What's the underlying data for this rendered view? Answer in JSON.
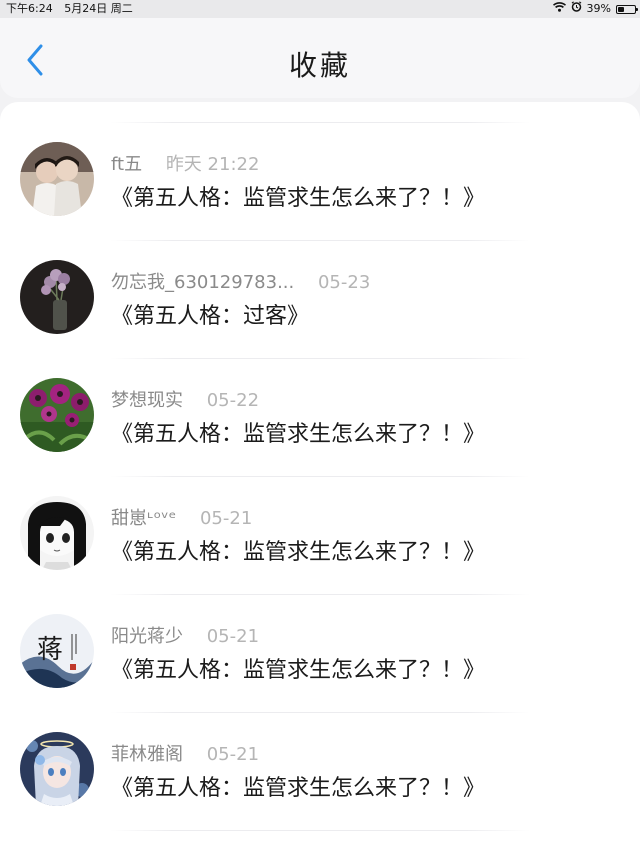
{
  "status_bar": {
    "time": "下午6:24",
    "date": "5月24日 周二",
    "battery_label": "39%",
    "battery_level": 0.39
  },
  "header": {
    "title": "收藏"
  },
  "colors": {
    "accent": "#2f8fe8"
  },
  "icons": {
    "back": "chevron-left-icon",
    "wifi": "wifi-icon",
    "alarm": "alarm-icon",
    "battery": "battery-icon"
  },
  "favorites": [
    {
      "nickname": "ft五",
      "time": "昨天 21:22",
      "title": "《第五人格：监管求生怎么来了？！》"
    },
    {
      "nickname": "勿忘我_630129783...",
      "time": "05-23",
      "title": "《第五人格：过客》"
    },
    {
      "nickname": "梦想现实",
      "time": "05-22",
      "title": "《第五人格：监管求生怎么来了？！》"
    },
    {
      "nickname": "甜崽ᶫᵒᵛᵉ",
      "time": "05-21",
      "title": "《第五人格：监管求生怎么来了？！》"
    },
    {
      "nickname": "阳光蒋少",
      "time": "05-21",
      "title": "《第五人格：监管求生怎么来了？！》"
    },
    {
      "nickname": "菲林雅阁",
      "time": "05-21",
      "title": "《第五人格：监管求生怎么来了？！》"
    }
  ]
}
